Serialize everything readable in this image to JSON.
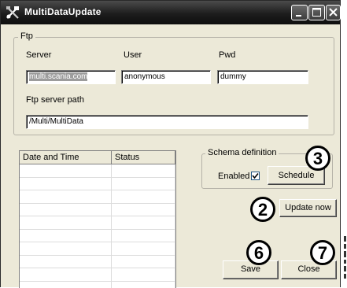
{
  "window": {
    "title": "MultiDataUpdate"
  },
  "ftp": {
    "legend": "Ftp",
    "server_label": "Server",
    "user_label": "User",
    "pwd_label": "Pwd",
    "server_value": "multi.scania.com",
    "user_value": "anonymous",
    "pwd_value": "dummy",
    "path_label": "Ftp server path",
    "path_value": "/Multi/MultiData"
  },
  "log_table": {
    "columns": [
      "Date and Time",
      "Status"
    ],
    "rows": []
  },
  "schema": {
    "legend": "Schema definition",
    "enabled_label": "Enabled",
    "enabled_checked": true,
    "schedule_label": "Schedule"
  },
  "buttons": {
    "update_now": "Update now",
    "save": "Save",
    "close": "Close"
  },
  "callouts": {
    "c3": "3",
    "c2": "2",
    "c6": "6",
    "c7": "7"
  }
}
